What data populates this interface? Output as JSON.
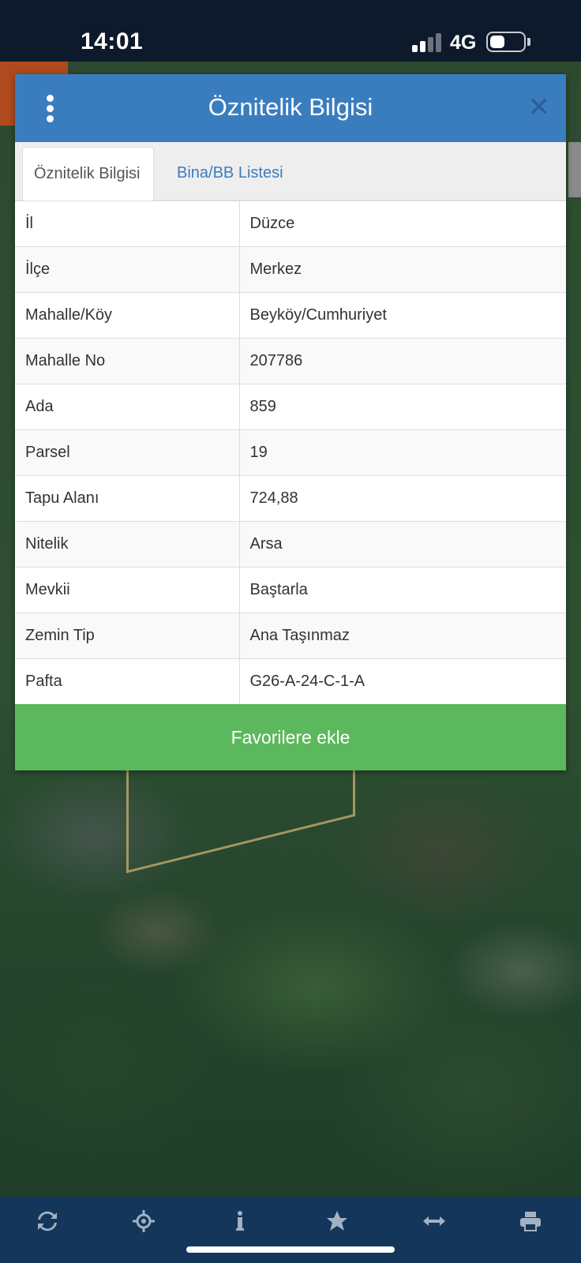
{
  "status_bar": {
    "time": "14:01",
    "network": "4G"
  },
  "modal": {
    "title": "Öznitelik Bilgisi",
    "tabs": [
      {
        "label": "Öznitelik Bilgisi",
        "active": true
      },
      {
        "label": "Bina/BB Listesi",
        "active": false
      }
    ],
    "rows": [
      {
        "key": "İl",
        "value": "Düzce"
      },
      {
        "key": "İlçe",
        "value": "Merkez"
      },
      {
        "key": "Mahalle/Köy",
        "value": "Beyköy/Cumhuriyet"
      },
      {
        "key": "Mahalle No",
        "value": "207786"
      },
      {
        "key": "Ada",
        "value": "859"
      },
      {
        "key": "Parsel",
        "value": "19"
      },
      {
        "key": "Tapu Alanı",
        "value": "724,88"
      },
      {
        "key": "Nitelik",
        "value": "Arsa"
      },
      {
        "key": "Mevkii",
        "value": "Baştarla"
      },
      {
        "key": "Zemin Tip",
        "value": "Ana Taşınmaz"
      },
      {
        "key": "Pafta",
        "value": "G26-A-24-C-1-A"
      }
    ],
    "favorite_button": "Favorilere ekle"
  },
  "toolbar": {
    "icons": [
      "refresh-icon",
      "crosshair-icon",
      "info-icon",
      "star-icon",
      "measure-icon",
      "print-icon"
    ]
  },
  "colors": {
    "header": "#3a7dbf",
    "tab_link": "#3a7dbf",
    "favorite_button": "#5cb85c",
    "toolbar": "#14365a",
    "status_bar": "#0d1a2b"
  }
}
